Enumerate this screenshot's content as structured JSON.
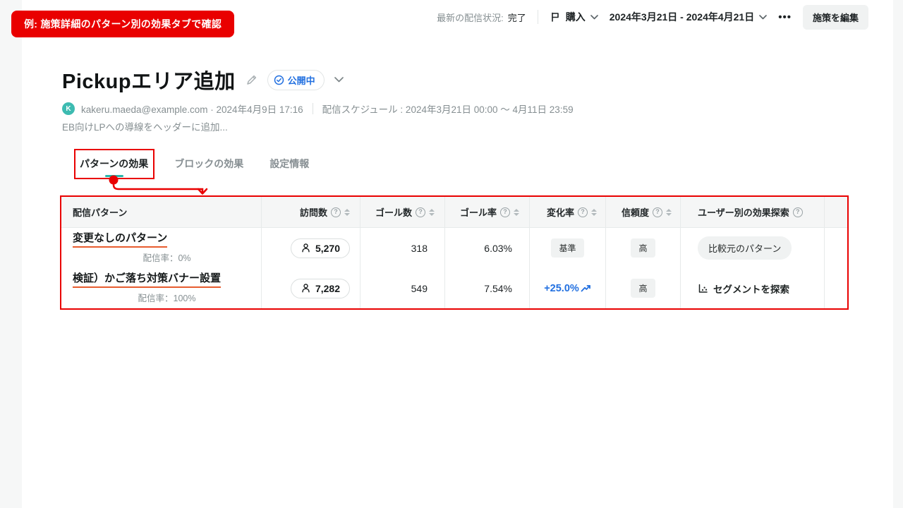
{
  "annotation": {
    "callout": "例: 施策詳細のパターン別の効果タブで確認"
  },
  "topbar": {
    "status_label": "最新の配信状況:",
    "status_value": "完了",
    "goal_label": "購入",
    "date_range": "2024年3月21日 - 2024年4月21日",
    "more_label": "•••",
    "edit_button": "施策を編集"
  },
  "header": {
    "title": "Pickupエリア追加",
    "status_badge": "公開中",
    "avatar_initial": "K",
    "meta": "kakeru.maeda@example.com · 2024年4月9日 17:16",
    "schedule": "配信スケジュール : 2024年3月21日 00:00 〜 4月11日 23:59",
    "description": "EB向けLPへの導線をヘッダーに追加..."
  },
  "tabs": [
    {
      "label": "パターンの効果",
      "active": true
    },
    {
      "label": "ブロックの効果",
      "active": false
    },
    {
      "label": "設定情報",
      "active": false
    }
  ],
  "table": {
    "columns": {
      "pattern": "配信パターン",
      "visits": "訪問数",
      "goals": "ゴール数",
      "goal_rate": "ゴール率",
      "change_rate": "変化率",
      "confidence": "信頼度",
      "explore": "ユーザー別の効果探索"
    },
    "rows": [
      {
        "pattern": "変更なしのパターン",
        "delivery_rate": "配信率：0%",
        "visits": "5,270",
        "goals": "318",
        "goal_rate": "6.03%",
        "change_rate": "基準",
        "confidence": "高",
        "explore": "比較元のパターン"
      },
      {
        "pattern": "検証）かご落ち対策バナー設置",
        "delivery_rate": "配信率：100%",
        "visits": "7,282",
        "goals": "549",
        "goal_rate": "7.54%",
        "change_rate": "+25.0%",
        "confidence": "高",
        "explore": "セグメントを探索"
      }
    ]
  },
  "colors": {
    "red": "#e90000",
    "teal": "#2ab5ab",
    "blue": "#2270e0",
    "orange": "#e75c2f",
    "avatar": "#3dbbb1"
  }
}
